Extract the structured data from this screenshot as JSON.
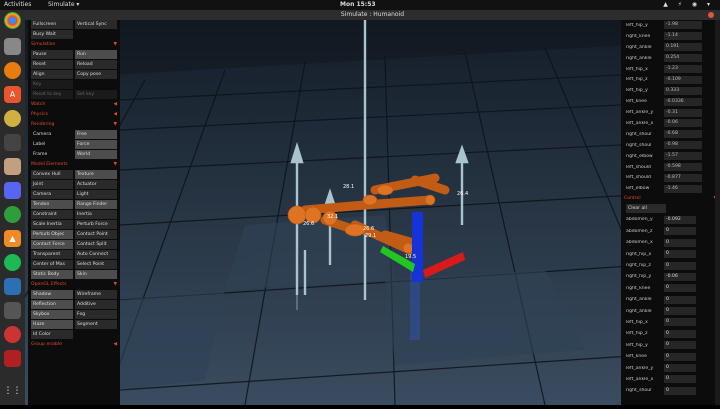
{
  "topbar": {
    "activities": "Activities",
    "app": "Simulate ▾",
    "clock": "Mon 15:53",
    "tray": "▲ ⚡ ◉ ▾"
  },
  "window": {
    "title": "Simulate : Humanoid"
  },
  "left": {
    "top_rows": [
      [
        "Fullscreen",
        "Vertical Sync"
      ],
      [
        "Busy Wait",
        ""
      ]
    ],
    "sections": [
      {
        "title": "Simulation",
        "rows": [
          [
            "Pause",
            "Run"
          ],
          [
            "Reset",
            "Reload"
          ],
          [
            "Align",
            "Copy pose"
          ],
          [
            "Key",
            ""
          ],
          [
            "Reset to key",
            "Set key"
          ]
        ]
      },
      {
        "title": "Watch",
        "rows": []
      },
      {
        "title": "Physics",
        "rows": []
      },
      {
        "title": "Rendering",
        "rows": [
          [
            "Camera",
            "Free"
          ],
          [
            "Label",
            "Force"
          ],
          [
            "Frame",
            "World"
          ]
        ]
      },
      {
        "title": "Model Elements",
        "rows": [
          [
            "Convex Hull",
            "Texture"
          ],
          [
            "Joint",
            "Actuator"
          ],
          [
            "Camera",
            "Light"
          ],
          [
            "Tendon",
            "Range Finder"
          ],
          [
            "Constraint",
            "Inertia"
          ],
          [
            "Scale Inertia",
            "Perturb Force"
          ],
          [
            "Perturb Objec",
            "Contact Point"
          ],
          [
            "Contact Force",
            "Contact Split"
          ],
          [
            "Transparent",
            "Auto Connect"
          ],
          [
            "Center of Mas",
            "Select Point"
          ],
          [
            "Static Body",
            "Skin"
          ]
        ]
      },
      {
        "title": "OpenGL Effects",
        "rows": [
          [
            "Shadow",
            "Wireframe"
          ],
          [
            "Reflection",
            "Additive"
          ],
          [
            "Skybox",
            "Fog"
          ],
          [
            "Haze",
            "Segment"
          ],
          [
            "Id Color",
            ""
          ]
        ]
      },
      {
        "title": "Group enable",
        "rows": []
      }
    ]
  },
  "right": {
    "joints": [
      [
        "left_hip_y",
        "-1.98"
      ],
      [
        "right_knee",
        "-1.14"
      ],
      [
        "right_ankle",
        "0.191"
      ],
      [
        "right_ankle",
        "0.254"
      ],
      [
        "left_hip_x",
        "-1.23"
      ],
      [
        "left_hip_z",
        "-0.109"
      ],
      [
        "left_hip_y",
        "0.333"
      ],
      [
        "left_knee",
        "-0.0336"
      ],
      [
        "left_ankle_y",
        "-0.31"
      ],
      [
        "left_ankle_x",
        "-0.06"
      ],
      [
        "right_shoul",
        "-0.68"
      ],
      [
        "right_shoul",
        "-0.98"
      ],
      [
        "right_elbow",
        "-1.57"
      ],
      [
        "left_should",
        "-0.598"
      ],
      [
        "left_should",
        "-0.877"
      ],
      [
        "left_elbow",
        "-1.46"
      ]
    ],
    "control_title": "Control",
    "clear_all": "Clear all",
    "controls": [
      [
        "abdomen_y",
        "-0.092"
      ],
      [
        "abdomen_z",
        "0"
      ],
      [
        "abdomen_x",
        "0"
      ],
      [
        "right_hip_x",
        "0"
      ],
      [
        "right_hip_z",
        "0"
      ],
      [
        "right_hip_y",
        "-0.06"
      ],
      [
        "right_knee",
        "0"
      ],
      [
        "right_ankle",
        "0"
      ],
      [
        "right_ankle",
        "0"
      ],
      [
        "left_hip_x",
        "0"
      ],
      [
        "left_hip_z",
        "0"
      ],
      [
        "left_hip_y",
        "0"
      ],
      [
        "left_knee",
        "0"
      ],
      [
        "left_ankle_y",
        "0"
      ],
      [
        "left_ankle_x",
        "0"
      ],
      [
        "right_shoul",
        "0"
      ]
    ]
  },
  "scene": {
    "labels": [
      "26.4",
      "28.1",
      "32.1",
      "26.6",
      "26.6",
      "29.1",
      "19.5"
    ]
  },
  "colors": {
    "accent": "#e04a2e",
    "body": "#d86b1e",
    "grid_dark": "#1b2530",
    "grid_light": "#3b4f62"
  }
}
